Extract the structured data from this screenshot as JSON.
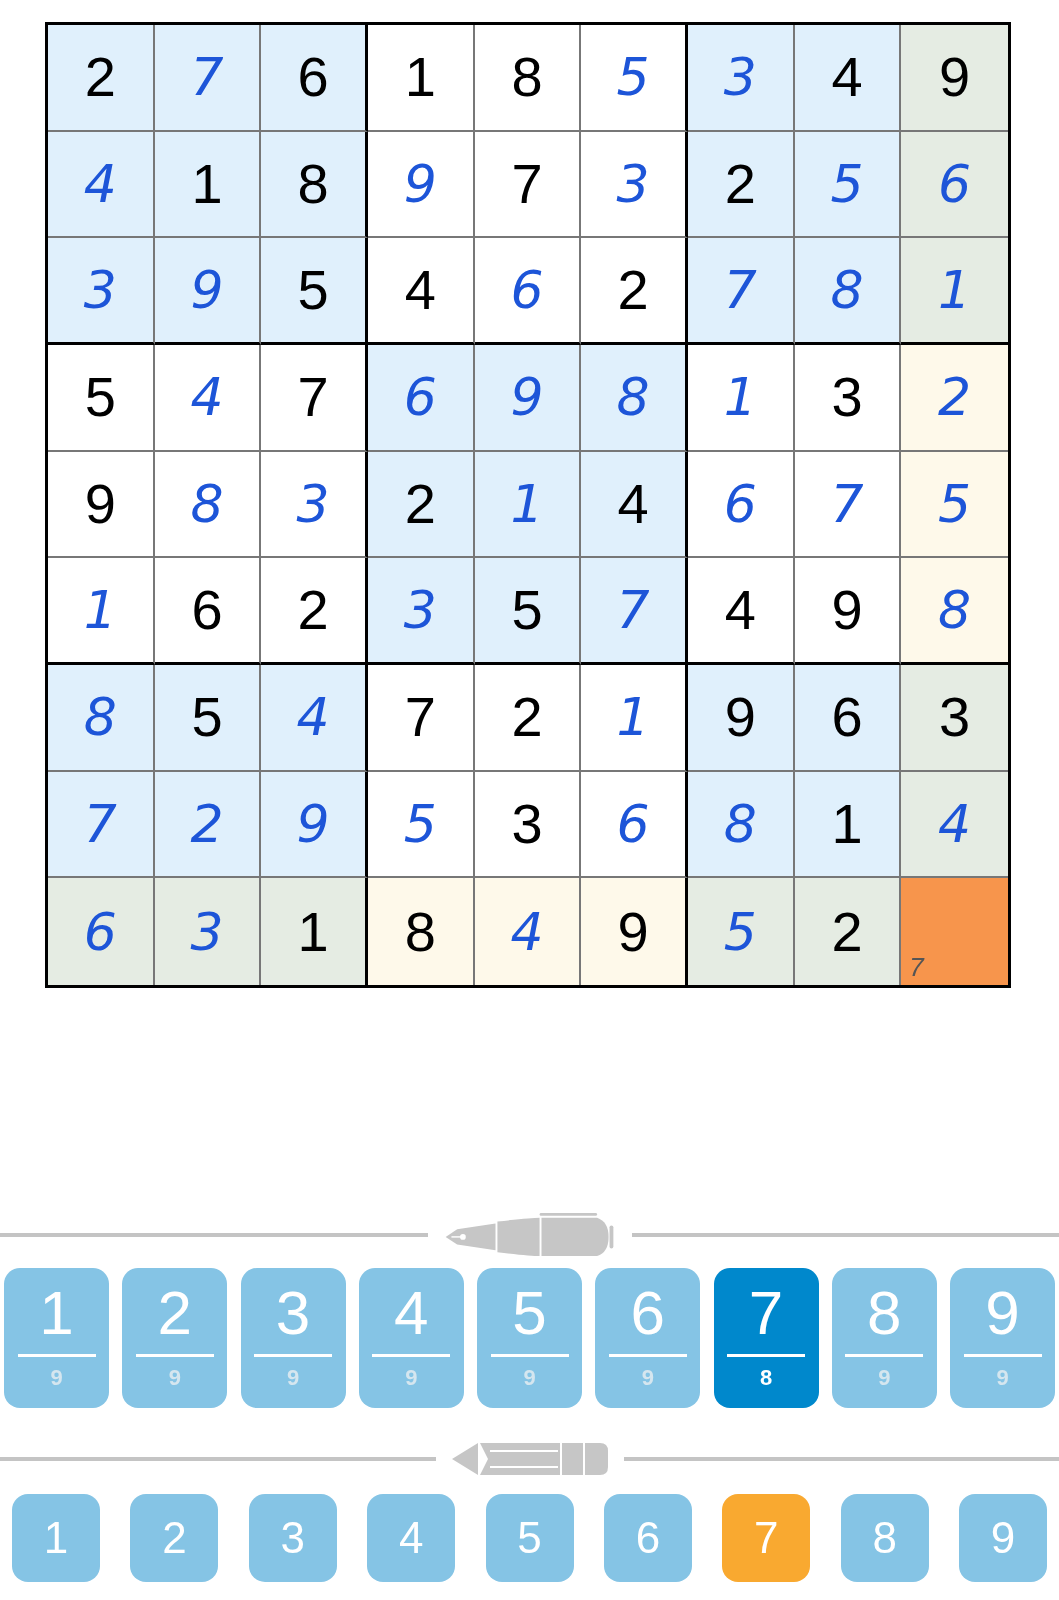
{
  "grid": {
    "rows": [
      {
        "cells": [
          {
            "value": "2",
            "kind": "given",
            "shaded": true,
            "in_line": false,
            "selected": false
          },
          {
            "value": "7",
            "kind": "entered",
            "shaded": true,
            "in_line": false,
            "selected": false
          },
          {
            "value": "6",
            "kind": "given",
            "shaded": true,
            "in_line": false,
            "selected": false
          },
          {
            "value": "1",
            "kind": "given",
            "shaded": false,
            "in_line": false,
            "selected": false
          },
          {
            "value": "8",
            "kind": "given",
            "shaded": false,
            "in_line": false,
            "selected": false
          },
          {
            "value": "5",
            "kind": "entered",
            "shaded": false,
            "in_line": false,
            "selected": false
          },
          {
            "value": "3",
            "kind": "entered",
            "shaded": true,
            "in_line": false,
            "selected": false
          },
          {
            "value": "4",
            "kind": "given",
            "shaded": true,
            "in_line": false,
            "selected": false
          },
          {
            "value": "9",
            "kind": "given",
            "shaded": true,
            "in_line": true,
            "selected": false
          }
        ]
      },
      {
        "cells": [
          {
            "value": "4",
            "kind": "entered",
            "shaded": true,
            "in_line": false,
            "selected": false
          },
          {
            "value": "1",
            "kind": "given",
            "shaded": true,
            "in_line": false,
            "selected": false
          },
          {
            "value": "8",
            "kind": "given",
            "shaded": true,
            "in_line": false,
            "selected": false
          },
          {
            "value": "9",
            "kind": "entered",
            "shaded": false,
            "in_line": false,
            "selected": false
          },
          {
            "value": "7",
            "kind": "given",
            "shaded": false,
            "in_line": false,
            "selected": false
          },
          {
            "value": "3",
            "kind": "entered",
            "shaded": false,
            "in_line": false,
            "selected": false
          },
          {
            "value": "2",
            "kind": "given",
            "shaded": true,
            "in_line": false,
            "selected": false
          },
          {
            "value": "5",
            "kind": "entered",
            "shaded": true,
            "in_line": false,
            "selected": false
          },
          {
            "value": "6",
            "kind": "entered",
            "shaded": true,
            "in_line": true,
            "selected": false
          }
        ]
      },
      {
        "cells": [
          {
            "value": "3",
            "kind": "entered",
            "shaded": true,
            "in_line": false,
            "selected": false
          },
          {
            "value": "9",
            "kind": "entered",
            "shaded": true,
            "in_line": false,
            "selected": false
          },
          {
            "value": "5",
            "kind": "given",
            "shaded": true,
            "in_line": false,
            "selected": false
          },
          {
            "value": "4",
            "kind": "given",
            "shaded": false,
            "in_line": false,
            "selected": false
          },
          {
            "value": "6",
            "kind": "entered",
            "shaded": false,
            "in_line": false,
            "selected": false
          },
          {
            "value": "2",
            "kind": "given",
            "shaded": false,
            "in_line": false,
            "selected": false
          },
          {
            "value": "7",
            "kind": "entered",
            "shaded": true,
            "in_line": false,
            "selected": false
          },
          {
            "value": "8",
            "kind": "entered",
            "shaded": true,
            "in_line": false,
            "selected": false
          },
          {
            "value": "1",
            "kind": "entered",
            "shaded": true,
            "in_line": true,
            "selected": false
          }
        ]
      },
      {
        "cells": [
          {
            "value": "5",
            "kind": "given",
            "shaded": false,
            "in_line": false,
            "selected": false
          },
          {
            "value": "4",
            "kind": "entered",
            "shaded": false,
            "in_line": false,
            "selected": false
          },
          {
            "value": "7",
            "kind": "given",
            "shaded": false,
            "in_line": false,
            "selected": false
          },
          {
            "value": "6",
            "kind": "entered",
            "shaded": true,
            "in_line": false,
            "selected": false
          },
          {
            "value": "9",
            "kind": "entered",
            "shaded": true,
            "in_line": false,
            "selected": false
          },
          {
            "value": "8",
            "kind": "entered",
            "shaded": true,
            "in_line": false,
            "selected": false
          },
          {
            "value": "1",
            "kind": "entered",
            "shaded": false,
            "in_line": false,
            "selected": false
          },
          {
            "value": "3",
            "kind": "given",
            "shaded": false,
            "in_line": false,
            "selected": false
          },
          {
            "value": "2",
            "kind": "entered",
            "shaded": false,
            "in_line": true,
            "selected": false
          }
        ]
      },
      {
        "cells": [
          {
            "value": "9",
            "kind": "given",
            "shaded": false,
            "in_line": false,
            "selected": false
          },
          {
            "value": "8",
            "kind": "entered",
            "shaded": false,
            "in_line": false,
            "selected": false
          },
          {
            "value": "3",
            "kind": "entered",
            "shaded": false,
            "in_line": false,
            "selected": false
          },
          {
            "value": "2",
            "kind": "given",
            "shaded": true,
            "in_line": false,
            "selected": false
          },
          {
            "value": "1",
            "kind": "entered",
            "shaded": true,
            "in_line": false,
            "selected": false
          },
          {
            "value": "4",
            "kind": "given",
            "shaded": true,
            "in_line": false,
            "selected": false
          },
          {
            "value": "6",
            "kind": "entered",
            "shaded": false,
            "in_line": false,
            "selected": false
          },
          {
            "value": "7",
            "kind": "entered",
            "shaded": false,
            "in_line": false,
            "selected": false
          },
          {
            "value": "5",
            "kind": "entered",
            "shaded": false,
            "in_line": true,
            "selected": false
          }
        ]
      },
      {
        "cells": [
          {
            "value": "1",
            "kind": "entered",
            "shaded": false,
            "in_line": false,
            "selected": false
          },
          {
            "value": "6",
            "kind": "given",
            "shaded": false,
            "in_line": false,
            "selected": false
          },
          {
            "value": "2",
            "kind": "given",
            "shaded": false,
            "in_line": false,
            "selected": false
          },
          {
            "value": "3",
            "kind": "entered",
            "shaded": true,
            "in_line": false,
            "selected": false
          },
          {
            "value": "5",
            "kind": "given",
            "shaded": true,
            "in_line": false,
            "selected": false
          },
          {
            "value": "7",
            "kind": "entered",
            "shaded": true,
            "in_line": false,
            "selected": false
          },
          {
            "value": "4",
            "kind": "given",
            "shaded": false,
            "in_line": false,
            "selected": false
          },
          {
            "value": "9",
            "kind": "given",
            "shaded": false,
            "in_line": false,
            "selected": false
          },
          {
            "value": "8",
            "kind": "entered",
            "shaded": false,
            "in_line": true,
            "selected": false
          }
        ]
      },
      {
        "cells": [
          {
            "value": "8",
            "kind": "entered",
            "shaded": true,
            "in_line": false,
            "selected": false
          },
          {
            "value": "5",
            "kind": "given",
            "shaded": true,
            "in_line": false,
            "selected": false
          },
          {
            "value": "4",
            "kind": "entered",
            "shaded": true,
            "in_line": false,
            "selected": false
          },
          {
            "value": "7",
            "kind": "given",
            "shaded": false,
            "in_line": false,
            "selected": false
          },
          {
            "value": "2",
            "kind": "given",
            "shaded": false,
            "in_line": false,
            "selected": false
          },
          {
            "value": "1",
            "kind": "entered",
            "shaded": false,
            "in_line": false,
            "selected": false
          },
          {
            "value": "9",
            "kind": "given",
            "shaded": true,
            "in_line": false,
            "selected": false
          },
          {
            "value": "6",
            "kind": "given",
            "shaded": true,
            "in_line": false,
            "selected": false
          },
          {
            "value": "3",
            "kind": "given",
            "shaded": true,
            "in_line": true,
            "selected": false
          }
        ]
      },
      {
        "cells": [
          {
            "value": "7",
            "kind": "entered",
            "shaded": true,
            "in_line": false,
            "selected": false
          },
          {
            "value": "2",
            "kind": "entered",
            "shaded": true,
            "in_line": false,
            "selected": false
          },
          {
            "value": "9",
            "kind": "entered",
            "shaded": true,
            "in_line": false,
            "selected": false
          },
          {
            "value": "5",
            "kind": "entered",
            "shaded": false,
            "in_line": false,
            "selected": false
          },
          {
            "value": "3",
            "kind": "given",
            "shaded": false,
            "in_line": false,
            "selected": false
          },
          {
            "value": "6",
            "kind": "entered",
            "shaded": false,
            "in_line": false,
            "selected": false
          },
          {
            "value": "8",
            "kind": "entered",
            "shaded": true,
            "in_line": false,
            "selected": false
          },
          {
            "value": "1",
            "kind": "given",
            "shaded": true,
            "in_line": false,
            "selected": false
          },
          {
            "value": "4",
            "kind": "entered",
            "shaded": true,
            "in_line": true,
            "selected": false
          }
        ]
      },
      {
        "cells": [
          {
            "value": "6",
            "kind": "entered",
            "shaded": true,
            "in_line": true,
            "selected": false
          },
          {
            "value": "3",
            "kind": "entered",
            "shaded": true,
            "in_line": true,
            "selected": false
          },
          {
            "value": "1",
            "kind": "given",
            "shaded": true,
            "in_line": true,
            "selected": false
          },
          {
            "value": "8",
            "kind": "given",
            "shaded": false,
            "in_line": true,
            "selected": false
          },
          {
            "value": "4",
            "kind": "entered",
            "shaded": false,
            "in_line": true,
            "selected": false
          },
          {
            "value": "9",
            "kind": "given",
            "shaded": false,
            "in_line": true,
            "selected": false
          },
          {
            "value": "5",
            "kind": "entered",
            "shaded": true,
            "in_line": true,
            "selected": false
          },
          {
            "value": "2",
            "kind": "given",
            "shaded": true,
            "in_line": true,
            "selected": false
          },
          {
            "kind": "empty",
            "notes": [
              "7"
            ],
            "selected": true
          }
        ]
      }
    ]
  },
  "pen_keys": [
    {
      "digit": "1",
      "remaining": "9",
      "selected": false
    },
    {
      "digit": "2",
      "remaining": "9",
      "selected": false
    },
    {
      "digit": "3",
      "remaining": "9",
      "selected": false
    },
    {
      "digit": "4",
      "remaining": "9",
      "selected": false
    },
    {
      "digit": "5",
      "remaining": "9",
      "selected": false
    },
    {
      "digit": "6",
      "remaining": "9",
      "selected": false
    },
    {
      "digit": "7",
      "remaining": "8",
      "selected": true
    },
    {
      "digit": "8",
      "remaining": "9",
      "selected": false
    },
    {
      "digit": "9",
      "remaining": "9",
      "selected": false
    }
  ],
  "pencil_keys": [
    {
      "digit": "1",
      "selected": false
    },
    {
      "digit": "2",
      "selected": false
    },
    {
      "digit": "3",
      "selected": false
    },
    {
      "digit": "4",
      "selected": false
    },
    {
      "digit": "5",
      "selected": false
    },
    {
      "digit": "6",
      "selected": false
    },
    {
      "digit": "7",
      "selected": true
    },
    {
      "digit": "8",
      "selected": false
    },
    {
      "digit": "9",
      "selected": false
    }
  ]
}
